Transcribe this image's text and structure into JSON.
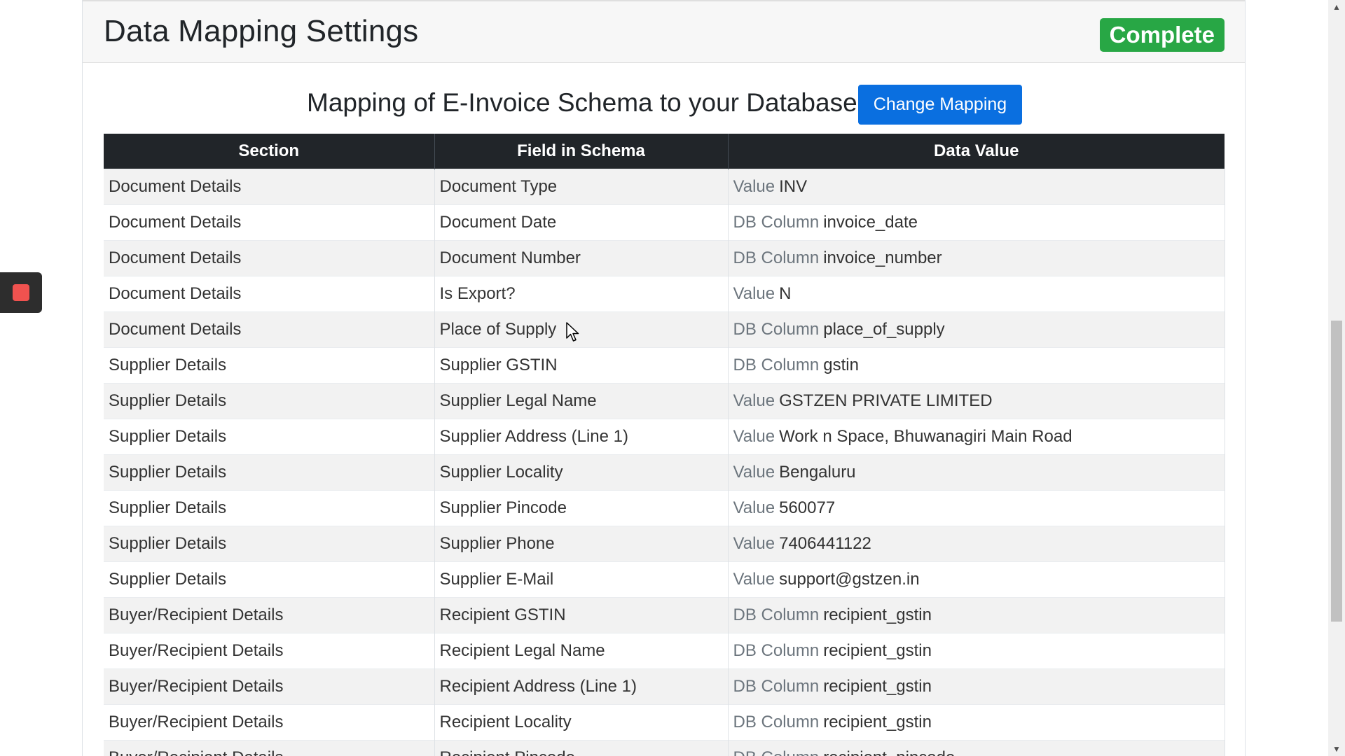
{
  "header": {
    "title": "Data Mapping Settings",
    "status_badge": "Complete"
  },
  "mapping": {
    "heading": "Mapping of E-Invoice Schema to your Database",
    "change_button": "Change Mapping"
  },
  "table": {
    "columns": [
      "Section",
      "Field in Schema",
      "Data Value"
    ],
    "rows": [
      {
        "section": "Document Details",
        "field": "Document Type",
        "type": "Value",
        "value": "INV"
      },
      {
        "section": "Document Details",
        "field": "Document Date",
        "type": "DB Column",
        "value": "invoice_date"
      },
      {
        "section": "Document Details",
        "field": "Document Number",
        "type": "DB Column",
        "value": "invoice_number"
      },
      {
        "section": "Document Details",
        "field": "Is Export?",
        "type": "Value",
        "value": "N"
      },
      {
        "section": "Document Details",
        "field": "Place of Supply",
        "type": "DB Column",
        "value": "place_of_supply"
      },
      {
        "section": "Supplier Details",
        "field": "Supplier GSTIN",
        "type": "DB Column",
        "value": "gstin"
      },
      {
        "section": "Supplier Details",
        "field": "Supplier Legal Name",
        "type": "Value",
        "value": "GSTZEN PRIVATE LIMITED"
      },
      {
        "section": "Supplier Details",
        "field": "Supplier Address (Line 1)",
        "type": "Value",
        "value": "Work n Space, Bhuwanagiri Main Road"
      },
      {
        "section": "Supplier Details",
        "field": "Supplier Locality",
        "type": "Value",
        "value": "Bengaluru"
      },
      {
        "section": "Supplier Details",
        "field": "Supplier Pincode",
        "type": "Value",
        "value": "560077"
      },
      {
        "section": "Supplier Details",
        "field": "Supplier Phone",
        "type": "Value",
        "value": "7406441122"
      },
      {
        "section": "Supplier Details",
        "field": "Supplier E-Mail",
        "type": "Value",
        "value": "support@gstzen.in"
      },
      {
        "section": "Buyer/Recipient Details",
        "field": "Recipient GSTIN",
        "type": "DB Column",
        "value": "recipient_gstin"
      },
      {
        "section": "Buyer/Recipient Details",
        "field": "Recipient Legal Name",
        "type": "DB Column",
        "value": "recipient_gstin"
      },
      {
        "section": "Buyer/Recipient Details",
        "field": "Recipient Address (Line 1)",
        "type": "DB Column",
        "value": "recipient_gstin"
      },
      {
        "section": "Buyer/Recipient Details",
        "field": "Recipient Locality",
        "type": "DB Column",
        "value": "recipient_gstin"
      },
      {
        "section": "Buyer/Recipient Details",
        "field": "Recipient Pincode",
        "type": "DB Column",
        "value": "recipient_pincode"
      }
    ]
  },
  "colors": {
    "complete_badge": "#28a745",
    "primary_button": "#0a6fe0",
    "table_header": "#212529",
    "stop_icon": "#f0524f"
  },
  "icons": {
    "stop": "stop-icon",
    "cursor": "cursor-icon",
    "scroll_up": "scroll-up-icon",
    "scroll_down": "scroll-down-icon"
  }
}
